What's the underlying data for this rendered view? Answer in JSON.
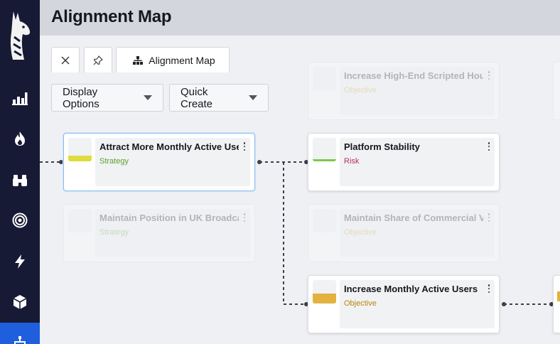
{
  "app": {
    "page_title": "Alignment Map"
  },
  "sidebar": {
    "items": [
      {
        "icon": "chart-bar-icon"
      },
      {
        "icon": "fire-icon"
      },
      {
        "icon": "binoculars-icon"
      },
      {
        "icon": "target-icon"
      },
      {
        "icon": "bolt-icon"
      },
      {
        "icon": "cube-icon"
      },
      {
        "icon": "hierarchy-icon",
        "active": true
      }
    ],
    "colors": {
      "background": "#171a35",
      "active": "#1f5fde"
    }
  },
  "tabs": [
    {
      "icon": "close-icon"
    },
    {
      "icon": "pin-icon"
    },
    {
      "icon": "sitemap-icon",
      "label": "Alignment Map"
    }
  ],
  "toolbar": {
    "display_options": "Display Options",
    "quick_create": "Quick Create"
  },
  "cards": [
    {
      "title": "Increase High-End Scripted Hou",
      "type": "Objective",
      "type_color": "#c9a227",
      "swatch": null,
      "faded": true
    },
    {
      "title": "Attract More Monthly Active Use",
      "type": "Strategy",
      "type_color": "#5aa02c",
      "swatch": "#dedd3c",
      "selected": true
    },
    {
      "title": "Platform Stability",
      "type": "Risk",
      "type_color": "#b3305f",
      "swatch": "#7bc94a"
    },
    {
      "title": "Maintain Position in UK Broadca",
      "type": "Strategy",
      "type_color": "#5aa02c",
      "swatch": null,
      "faded": true
    },
    {
      "title": "Maintain Share of Commercial V",
      "type": "Objective",
      "type_color": "#c9a227",
      "swatch": null,
      "faded": true
    },
    {
      "title": "Increase Monthly Active Users",
      "type": "Objective",
      "type_color": "#b8860b",
      "swatch": "#e3b23f"
    }
  ]
}
